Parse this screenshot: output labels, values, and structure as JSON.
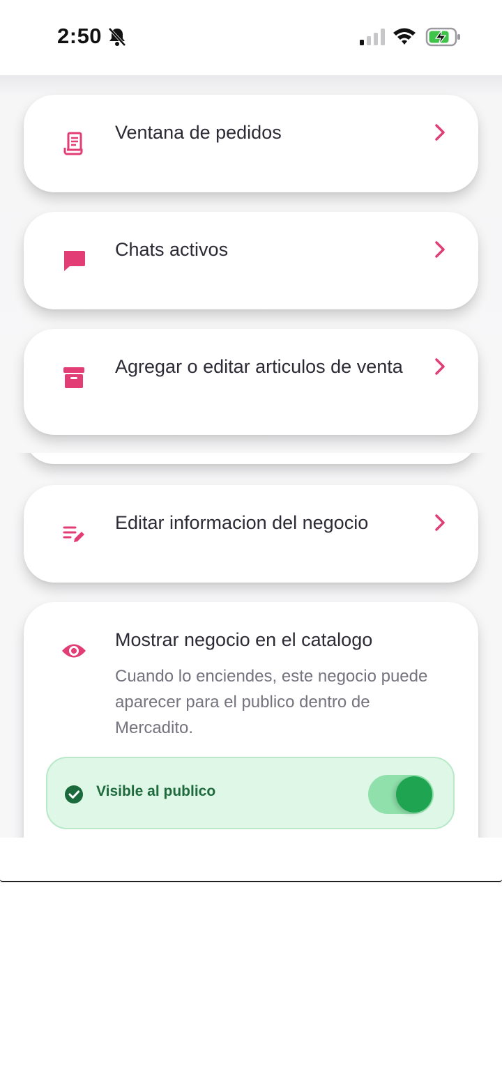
{
  "status_bar": {
    "time": "2:50",
    "icons": [
      "bell-off-icon",
      "signal-icon",
      "wifi-icon",
      "battery-charging-icon"
    ]
  },
  "menu": {
    "items": [
      {
        "label": "Ventana de pedidos",
        "icon": "receipt-icon"
      },
      {
        "label": "Chats activos",
        "icon": "chat-icon"
      },
      {
        "label": "Agregar o editar articulos de venta",
        "icon": "archive-box-icon"
      },
      {
        "label": "Editar informacion del negocio",
        "icon": "edit-list-icon"
      }
    ]
  },
  "catalog_card": {
    "title": "Mostrar negocio en el catalogo",
    "description": "Cuando lo enciendes, este negocio puede aparecer para el publico dentro de Mercadito.",
    "status_label": "Visible al publico",
    "toggle_on": true,
    "icon": "eye-icon"
  },
  "colors": {
    "accent": "#E23D74",
    "success": "#1FA552",
    "success_bg": "#DEF7E6"
  }
}
